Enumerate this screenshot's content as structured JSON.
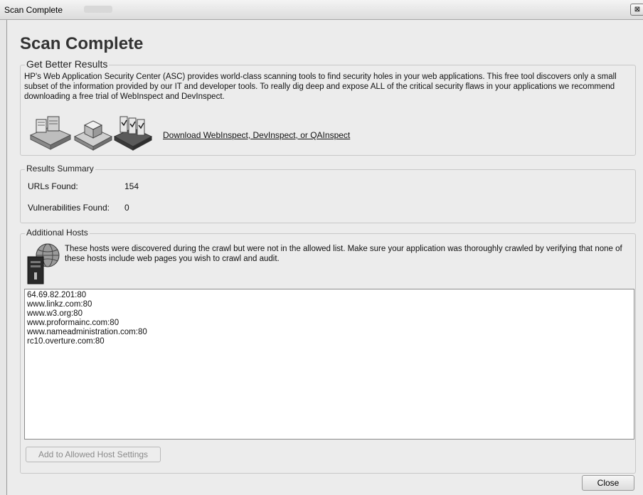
{
  "window": {
    "title": "Scan Complete",
    "close_glyph": "⊠"
  },
  "header": {
    "title": "Scan Complete"
  },
  "better_results": {
    "legend": "Get Better Results",
    "description": "HP's Web Application Security Center (ASC) provides world-class scanning tools to find security holes in your web applications.  This free tool discovers only a small subset of the information provided by our IT and developer tools.  To really dig deep and expose ALL of the critical security flaws in your applications we recommend downloading a free trial of WebInspect and DevInspect.",
    "download_link": "Download WebInspect, DevInspect, or QAInspect",
    "icons": [
      "webinspect-icon",
      "devinspect-icon",
      "qainspect-icon"
    ]
  },
  "results_summary": {
    "legend": "Results Summary",
    "urls_label": "URLs Found:",
    "urls_value": "154",
    "vulns_label": "Vulnerabilities Found:",
    "vulns_value": "0"
  },
  "additional_hosts": {
    "legend": "Additional Hosts",
    "icon": "server-globe-icon",
    "description": "These hosts were discovered during the crawl but were not in the allowed list. Make sure your application was thoroughly crawled by verifying that none of these hosts include web pages you wish to crawl and audit.",
    "hosts": [
      "64.69.82.201:80",
      "www.linkz.com:80",
      "www.w3.org:80",
      "www.proformainc.com:80",
      "www.nameadministration.com:80",
      "rc10.overture.com:80"
    ],
    "add_button": "Add to Allowed Host Settings"
  },
  "footer": {
    "close_button": "Close"
  }
}
